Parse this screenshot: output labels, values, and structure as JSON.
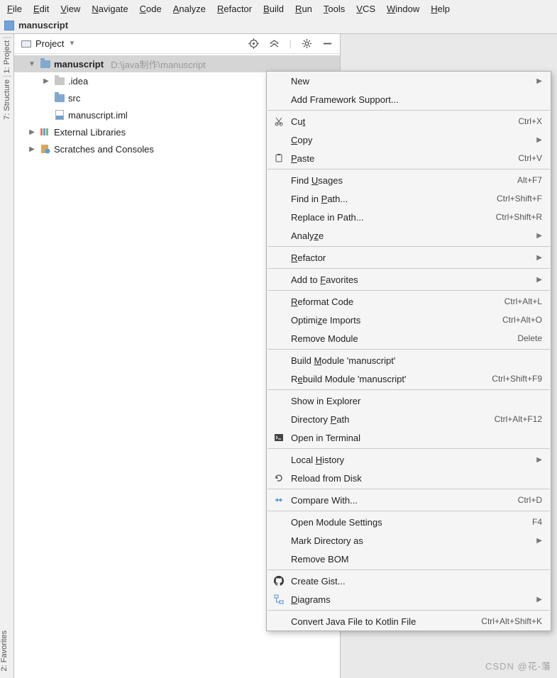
{
  "menubar": [
    "File",
    "Edit",
    "View",
    "Navigate",
    "Code",
    "Analyze",
    "Refactor",
    "Build",
    "Run",
    "Tools",
    "VCS",
    "Window",
    "Help"
  ],
  "breadcrumb": {
    "project": "manuscript"
  },
  "sidebar": {
    "header_label": "Project",
    "items": [
      {
        "arrow": "▼",
        "icon": "module",
        "name": "manuscript",
        "bold": true,
        "hint": "D:\\java制作\\manuscript",
        "depth": 0,
        "sel": true
      },
      {
        "arrow": "▶",
        "icon": "folder-dim",
        "name": ".idea",
        "depth": 1
      },
      {
        "arrow": "",
        "icon": "folder",
        "name": "src",
        "depth": 1
      },
      {
        "arrow": "",
        "icon": "iml",
        "name": "manuscript.iml",
        "depth": 1
      },
      {
        "arrow": "▶",
        "icon": "libs",
        "name": "External Libraries",
        "depth": 0
      },
      {
        "arrow": "▶",
        "icon": "scratch",
        "name": "Scratches and Consoles",
        "depth": 0
      }
    ]
  },
  "ctx": {
    "rows": [
      {
        "type": "item",
        "label": "New",
        "submenu": true
      },
      {
        "type": "item",
        "label": "Add Framework Support..."
      },
      {
        "type": "sep"
      },
      {
        "type": "item",
        "icon": "cut",
        "label": "Cut",
        "mnemonic": "t",
        "shortcut": "Ctrl+X"
      },
      {
        "type": "item",
        "label": "Copy",
        "mnemonic": "C",
        "submenu": true
      },
      {
        "type": "item",
        "icon": "paste",
        "label": "Paste",
        "mnemonic": "P",
        "shortcut": "Ctrl+V"
      },
      {
        "type": "sep"
      },
      {
        "type": "item",
        "label": "Find Usages",
        "mnemonic": "U",
        "shortcut": "Alt+F7"
      },
      {
        "type": "item",
        "label": "Find in Path...",
        "mnemonic": "P",
        "shortcut": "Ctrl+Shift+F"
      },
      {
        "type": "item",
        "label": "Replace in Path...",
        "shortcut": "Ctrl+Shift+R"
      },
      {
        "type": "item",
        "label": "Analyze",
        "mnemonic": "z",
        "submenu": true
      },
      {
        "type": "sep"
      },
      {
        "type": "item",
        "label": "Refactor",
        "mnemonic": "R",
        "submenu": true
      },
      {
        "type": "sep"
      },
      {
        "type": "item",
        "label": "Add to Favorites",
        "mnemonic": "F",
        "submenu": true
      },
      {
        "type": "sep"
      },
      {
        "type": "item",
        "label": "Reformat Code",
        "mnemonic": "R",
        "shortcut": "Ctrl+Alt+L"
      },
      {
        "type": "item",
        "label": "Optimize Imports",
        "mnemonic": "z",
        "shortcut": "Ctrl+Alt+O"
      },
      {
        "type": "item",
        "label": "Remove Module",
        "shortcut": "Delete"
      },
      {
        "type": "sep"
      },
      {
        "type": "item",
        "label": "Build Module 'manuscript'",
        "mnemonic": "M"
      },
      {
        "type": "item",
        "label": "Rebuild Module 'manuscript'",
        "mnemonic": "e",
        "shortcut": "Ctrl+Shift+F9"
      },
      {
        "type": "sep"
      },
      {
        "type": "item",
        "label": "Show in Explorer"
      },
      {
        "type": "item",
        "label": "Directory Path",
        "mnemonic": "P",
        "shortcut": "Ctrl+Alt+F12"
      },
      {
        "type": "item",
        "icon": "terminal",
        "label": "Open in Terminal"
      },
      {
        "type": "sep"
      },
      {
        "type": "item",
        "label": "Local History",
        "mnemonic": "H",
        "submenu": true
      },
      {
        "type": "item",
        "icon": "reload",
        "label": "Reload from Disk"
      },
      {
        "type": "sep"
      },
      {
        "type": "item",
        "icon": "compare",
        "label": "Compare With...",
        "shortcut": "Ctrl+D"
      },
      {
        "type": "sep"
      },
      {
        "type": "item",
        "label": "Open Module Settings",
        "shortcut": "F4"
      },
      {
        "type": "item",
        "label": "Mark Directory as",
        "submenu": true
      },
      {
        "type": "item",
        "label": "Remove BOM"
      },
      {
        "type": "sep"
      },
      {
        "type": "item",
        "icon": "github",
        "label": "Create Gist..."
      },
      {
        "type": "item",
        "icon": "diagram",
        "label": "Diagrams",
        "mnemonic": "D",
        "submenu": true
      },
      {
        "type": "sep"
      },
      {
        "type": "item",
        "label": "Convert Java File to Kotlin File",
        "shortcut": "Ctrl+Alt+Shift+K"
      }
    ]
  },
  "gutter": {
    "project": "1: Project",
    "structure": "7: Structure",
    "favorites": "2: Favorites"
  },
  "watermark": "CSDN @花-藩"
}
